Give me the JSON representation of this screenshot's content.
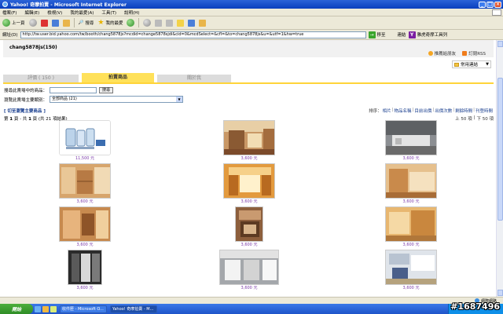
{
  "window": {
    "title": "Yahoo! 奇摩拍賣 - Microsoft Internet Explorer",
    "controls": [
      "_",
      "□",
      "×"
    ]
  },
  "menu": [
    "檔案(F)",
    "編輯(E)",
    "檢視(V)",
    "我的最愛(A)",
    "工具(T)",
    "說明(H)"
  ],
  "toolbar": {
    "back_label": "上一頁",
    "search_label": "搜尋",
    "favorites_label": "我的最愛"
  },
  "address": {
    "label": "網址(D)",
    "url": "http://tw.user.bid.yahoo.com/tw/booth/chang5878js?mcdid=change5878sjdi&cid=0&mcdSelect=&cfl=&to=chang5878js&u=&utf=1&hw=true",
    "go_label": "移至",
    "links_label": "連結",
    "yahoo_toolbar_label": "雅虎奇摩工具列"
  },
  "store": {
    "name": "chang5878js(150)",
    "link_add_friend": "推薦給朋友",
    "link_rss": "訂閱RSS",
    "common_channels": "常用連結"
  },
  "tabs": [
    {
      "label": "評價 ( 150 )",
      "active": false
    },
    {
      "label": "拍賣商品",
      "active": true
    },
    {
      "label": "關於我",
      "active": false
    }
  ],
  "search": {
    "label": "搜尋此賣場中的商品：",
    "value": "",
    "button": "搜尋"
  },
  "category": {
    "label": "瀏覽此賣場主要類別：",
    "selected": "全部商品 (21)"
  },
  "browse": {
    "link": "[ 切至瀏覽主要商品 ]",
    "sort_label": "排序：",
    "sort_options": [
      "相片",
      "物品名稱",
      "目前出價",
      "出價次數",
      "剩餘時間",
      "刊登時間"
    ]
  },
  "paging": {
    "summary_prefix": "第 ",
    "page": "1",
    "summary_mid": " 頁 - 共 ",
    "total_pages": "1",
    "summary_suffix": " 頁 (共 21 項結果)",
    "prev": "上 50 項",
    "next": "下 50 項"
  },
  "products": [
    {
      "price": "11,500 元",
      "thumb": "white"
    },
    {
      "price": "3,600 元",
      "thumb": "warm"
    },
    {
      "price": "3,600 元",
      "thumb": "gray"
    },
    {
      "price": "3,600 元",
      "thumb": "wood"
    },
    {
      "price": "3,600 元",
      "thumb": "orange"
    },
    {
      "price": "3,600 元",
      "thumb": "wood"
    },
    {
      "price": "3,600 元",
      "thumb": "wood"
    },
    {
      "price": "3,600 元",
      "thumb": "brown"
    },
    {
      "price": "3,600 元",
      "thumb": "wood"
    },
    {
      "price": "3,600 元",
      "thumb": "dark"
    },
    {
      "price": "3,600 元",
      "thumb": "gray"
    },
    {
      "price": "3,600 元",
      "thumb": "blue"
    }
  ],
  "status": {
    "zone": "網際網路"
  },
  "taskbar": {
    "start": "開始",
    "tasks": [
      "收件匣 - Microsoft O...",
      "Yahoo! 奇摩拍賣 - M..."
    ]
  },
  "watermark": "#1687496"
}
